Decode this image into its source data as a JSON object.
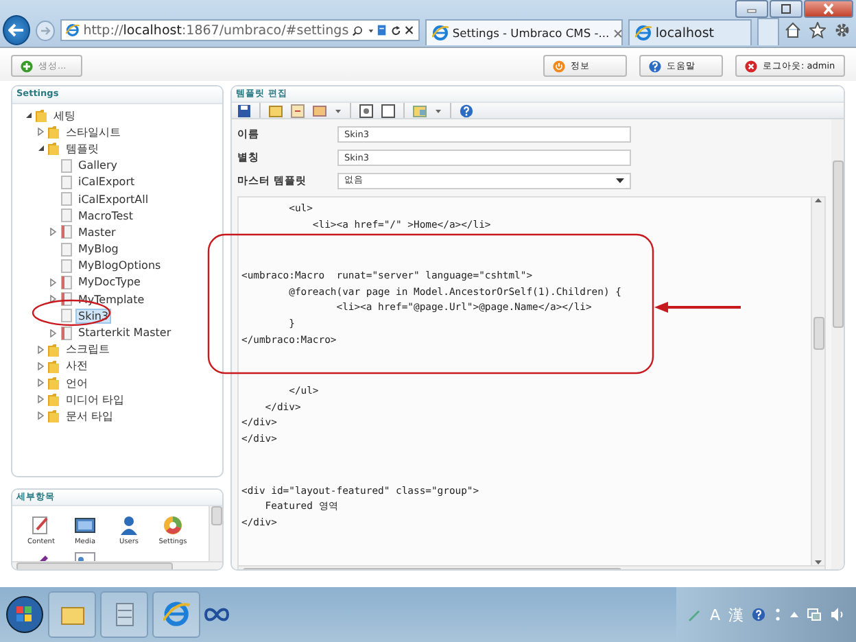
{
  "browser": {
    "url": "http://**localhost**:1867/umbraco/#settings",
    "tabs": [
      {
        "label": "Settings - Umbraco CMS -...",
        "selected": true
      },
      {
        "label": "localhost",
        "selected": false
      }
    ]
  },
  "app_toolbar": {
    "create_button": "생성...",
    "buttons": [
      "정보",
      "도움말",
      "로그아웃: admin"
    ]
  },
  "tree_panel": {
    "title": "Settings",
    "items": [
      {
        "label": "세팅",
        "expanded": true,
        "selected": false,
        "kind": "folder",
        "children": [
          {
            "label": "스타일시트",
            "expanded": false,
            "selected": false,
            "kind": "folder"
          },
          {
            "label": "템플릿",
            "expanded": true,
            "selected": false,
            "kind": "folder",
            "children": [
              {
                "label": "Gallery",
                "selected": false,
                "kind": "page"
              },
              {
                "label": "iCalExport",
                "selected": false,
                "kind": "page"
              },
              {
                "label": "iCalExportAll",
                "selected": false,
                "kind": "page"
              },
              {
                "label": "MacroTest",
                "selected": false,
                "kind": "page"
              },
              {
                "label": "Master",
                "expanded": false,
                "selected": false,
                "kind": "master"
              },
              {
                "label": "MyBlog",
                "selected": false,
                "kind": "page"
              },
              {
                "label": "MyBlogOptions",
                "selected": false,
                "kind": "page"
              },
              {
                "label": "MyDocType",
                "expanded": false,
                "selected": false,
                "kind": "master"
              },
              {
                "label": "MyTemplate",
                "expanded": false,
                "selected": false,
                "kind": "master"
              },
              {
                "label": "Skin3",
                "selected": true,
                "kind": "page"
              },
              {
                "label": "Starterkit Master",
                "expanded": false,
                "selected": false,
                "kind": "master"
              }
            ]
          },
          {
            "label": "스크립트",
            "expanded": false,
            "selected": false,
            "kind": "folder"
          },
          {
            "label": "사전",
            "expanded": false,
            "selected": false,
            "kind": "folder"
          },
          {
            "label": "언어",
            "expanded": false,
            "selected": false,
            "kind": "folder"
          },
          {
            "label": "미디어 타입",
            "expanded": false,
            "selected": false,
            "kind": "folder"
          },
          {
            "label": "문서 타입",
            "expanded": false,
            "selected": false,
            "kind": "folder"
          }
        ]
      }
    ]
  },
  "sections_panel": {
    "title": "세부항목",
    "items": [
      {
        "label": "Content",
        "kind": "content"
      },
      {
        "label": "Media",
        "kind": "media"
      },
      {
        "label": "Users",
        "kind": "users"
      },
      {
        "label": "Settings",
        "kind": "settings"
      },
      {
        "kind": "developer"
      },
      {
        "kind": "members"
      }
    ]
  },
  "editor": {
    "title": "템플릿 편집",
    "fields": [
      {
        "label": "이름",
        "value": "Skin3",
        "kind": "text"
      },
      {
        "label": "별칭",
        "value": "Skin3",
        "kind": "text"
      },
      {
        "label": "마스터 템플릿",
        "value": "없음",
        "kind": "select"
      }
    ],
    "code_blocks": [
      [
        "        <ul>",
        "            <li><a href=\"/\" >Home</a></li>"
      ],
      [
        "<umbraco:Macro  runat=\"server\" language=\"cshtml\">",
        "        @foreach(var page in Model.AncestorOrSelf(1).Children) {",
        "                <li><a href=\"@page.Url\">@page.Name</a></li>",
        "        }",
        "</umbraco:Macro>"
      ],
      [
        "        </ul>",
        "    </div>",
        "</div>",
        "</div>"
      ],
      [
        "<div id=\"layout-featured\" class=\"group\">",
        "    Featured 영역",
        "</div>"
      ]
    ]
  },
  "taskbar": {
    "tray": [
      "A",
      "漢"
    ]
  }
}
